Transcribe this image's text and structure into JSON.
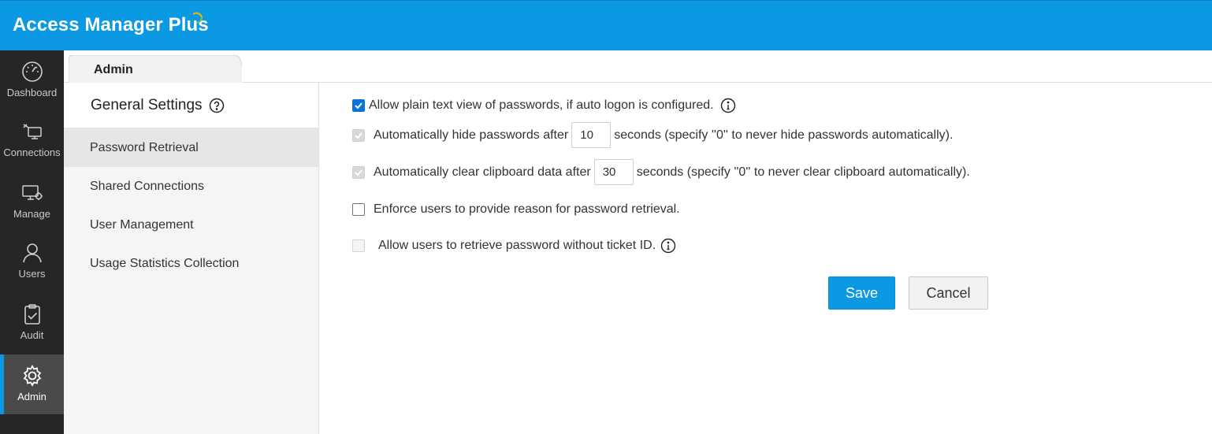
{
  "app": {
    "title": "Access Manager Plus",
    "accent_color": "#0a99e2",
    "nav_bg": "#262626"
  },
  "leftnav": {
    "items": [
      {
        "label": "Dashboard",
        "icon": "gauge-icon"
      },
      {
        "label": "Connections",
        "icon": "connections-icon"
      },
      {
        "label": "Manage",
        "icon": "monitor-gear-icon"
      },
      {
        "label": "Users",
        "icon": "user-icon"
      },
      {
        "label": "Audit",
        "icon": "clipboard-check-icon"
      },
      {
        "label": "Admin",
        "icon": "gear-icon",
        "active": true
      }
    ]
  },
  "tabs": {
    "active": "Admin"
  },
  "sidepanel": {
    "title": "General Settings",
    "help_icon": "question-circle-icon",
    "items": [
      {
        "label": "Password Retrieval",
        "active": true
      },
      {
        "label": "Shared Connections"
      },
      {
        "label": "User Management"
      },
      {
        "label": "Usage Statistics Collection"
      }
    ]
  },
  "settings": {
    "plain_text": {
      "label": "Allow plain text view of passwords, if auto logon is configured.",
      "checked": true,
      "info_icon": "info-circle-icon"
    },
    "auto_hide": {
      "prefix": "Automatically hide passwords after",
      "value": "10",
      "suffix": "seconds (specify ''0'' to never hide passwords automatically).",
      "checked": true,
      "disabled": true
    },
    "clear_clipboard": {
      "prefix": "Automatically clear clipboard data after",
      "value": "30",
      "suffix": "seconds (specify ''0'' to never clear clipboard automatically).",
      "checked": true,
      "disabled": true
    },
    "enforce_reason": {
      "label": "Enforce users to provide reason for password retrieval.",
      "checked": false
    },
    "ticket_id": {
      "label": "Allow users to retrieve password without ticket ID.",
      "checked": false,
      "disabled": true,
      "info_icon": "info-circle-icon"
    }
  },
  "actions": {
    "save_label": "Save",
    "cancel_label": "Cancel"
  }
}
